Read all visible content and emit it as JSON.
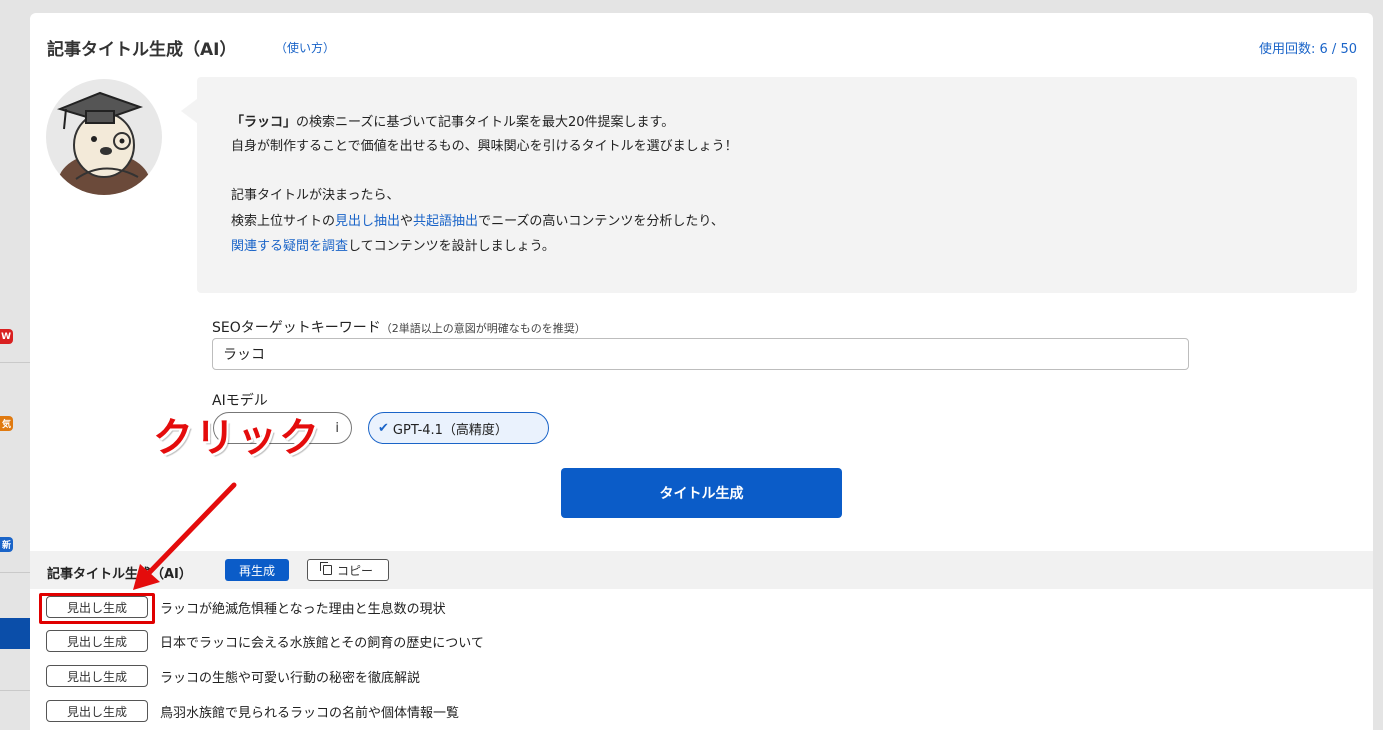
{
  "sidebar": {
    "badges": [
      {
        "text": "W",
        "color": "#d92020"
      },
      {
        "text": "気",
        "color": "#e07a10"
      },
      {
        "text": "新",
        "color": "#1a64c8"
      }
    ]
  },
  "header": {
    "title": "記事タイトル生成（AI）",
    "howto_link": "（使い方）",
    "usage": "使用回数: 6 / 50"
  },
  "intro": {
    "line1_bold": "「ラッコ」",
    "line1_rest": "の検索ニーズに基づいて記事タイトル案を最大20件提案します。",
    "line2": "自身が制作することで価値を出せるもの、興味関心を引けるタイトルを選びましょう！",
    "line3": "記事タイトルが決まったら、",
    "line4_a": "検索上位サイトの",
    "line4_link1": "見出し抽出",
    "line4_b": "や",
    "line4_link2": "共起語抽出",
    "line4_c": "でニーズの高いコンテンツを分析したり、",
    "line5_link": "関連する疑問を調査",
    "line5_rest": "してコンテンツを設計しましょう。"
  },
  "form": {
    "keyword_label": "SEOターゲットキーワード",
    "keyword_hint": "（2単語以上の意図が明確なものを推奨）",
    "keyword_value": "ラッコ",
    "model_label": "AIモデル",
    "model_a_label": "i",
    "model_b_label": "GPT-4.1（高精度）",
    "generate_label": "タイトル生成"
  },
  "results": {
    "title": "記事タイトル生成（AI）",
    "regen_label": "再生成",
    "copy_label": "コピー",
    "row_button_label": "見出し生成",
    "items": [
      "ラッコが絶滅危惧種となった理由と生息数の現状",
      "日本でラッコに会える水族館とその飼育の歴史について",
      "ラッコの生態や可愛い行動の秘密を徹底解説",
      "鳥羽水族館で見られるラッコの名前や個体情報一覧"
    ]
  },
  "annotation": {
    "click_text": "クリック",
    "color": "#e40c0c"
  },
  "colors": {
    "accent": "#0b5cc8",
    "link": "#1a64c8"
  }
}
